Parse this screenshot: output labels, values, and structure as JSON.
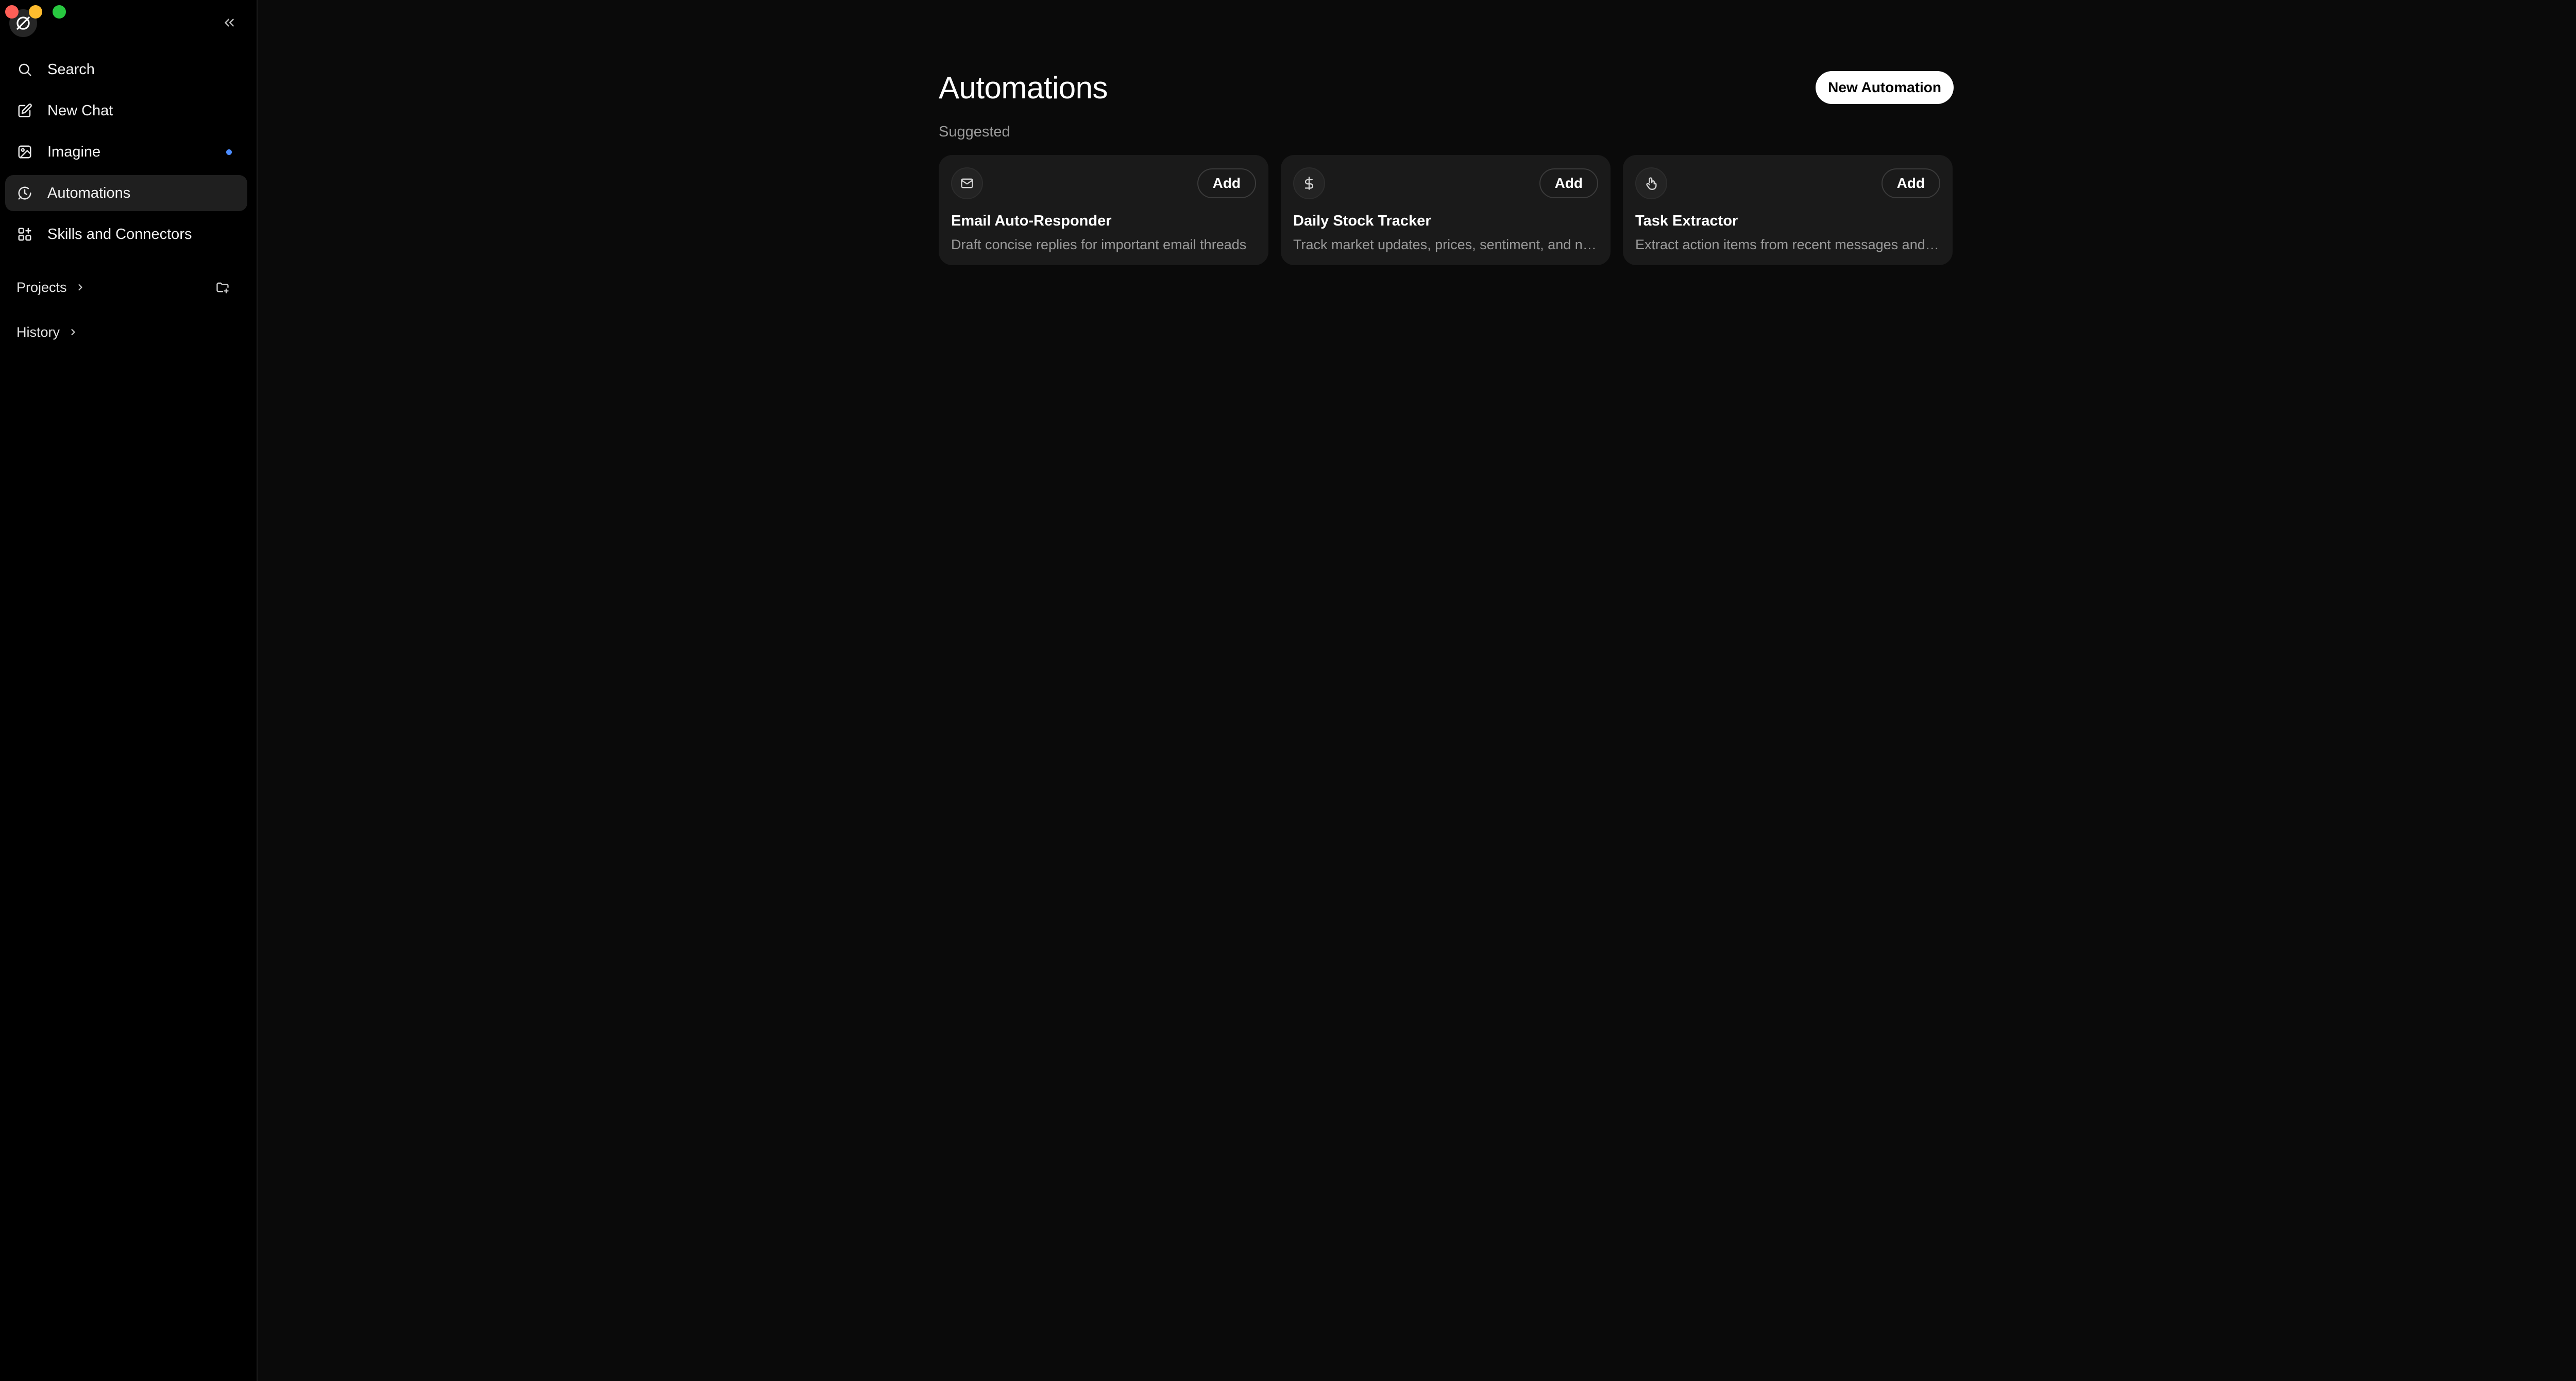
{
  "sidebar": {
    "items": [
      {
        "label": "Search",
        "icon": "search-icon"
      },
      {
        "label": "New Chat",
        "icon": "edit-icon"
      },
      {
        "label": "Imagine",
        "icon": "image-cube-icon"
      },
      {
        "label": "Automations",
        "icon": "clock-chat-icon",
        "active": true
      },
      {
        "label": "Skills and Connectors",
        "icon": "grid-plus-icon"
      }
    ],
    "projects_label": "Projects",
    "history_label": "History"
  },
  "main": {
    "title": "Automations",
    "new_automation_label": "New Automation",
    "suggested_label": "Suggested",
    "cards": [
      {
        "icon": "mail-icon",
        "title": "Email Auto-Responder",
        "description": "Draft concise replies for important email threads",
        "add_label": "Add"
      },
      {
        "icon": "dollar-icon",
        "title": "Daily Stock Tracker",
        "description": "Track market updates, prices, sentiment, and news",
        "add_label": "Add"
      },
      {
        "icon": "hand-pointer-icon",
        "title": "Task Extractor",
        "description": "Extract action items from recent messages and threads",
        "add_label": "Add"
      }
    ]
  },
  "colors": {
    "background": "#0a0a0a",
    "sidebar": "#000000",
    "card": "#1a1a1a",
    "accent_dot": "#4c8dff"
  }
}
